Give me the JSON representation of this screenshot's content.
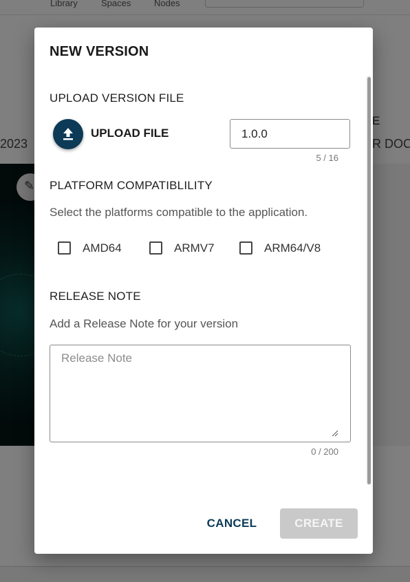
{
  "background": {
    "nav_links": [
      "Library",
      "Spaces",
      "Nodes"
    ],
    "date_fragment": "2023",
    "column_fragment": "E",
    "doc_fragment": "R DOC"
  },
  "dialog": {
    "title": "NEW VERSION",
    "upload_section": {
      "label": "UPLOAD VERSION FILE",
      "button_label": "UPLOAD FILE",
      "icon": "upload-icon",
      "version_value": "1.0.0",
      "version_counter": "5 / 16"
    },
    "platform_section": {
      "label": "PLATFORM COMPATIBLILITY",
      "description": "Select the platforms compatible to the application.",
      "options": [
        {
          "label": "AMD64",
          "checked": false
        },
        {
          "label": "ARMV7",
          "checked": false
        },
        {
          "label": "ARM64/V8",
          "checked": false
        }
      ]
    },
    "release_note_section": {
      "label": "RELEASE NOTE",
      "description": "Add a Release Note for your version",
      "placeholder": "Release Note",
      "counter": "0 / 200"
    },
    "actions": {
      "cancel_label": "CANCEL",
      "create_label": "CREATE"
    }
  },
  "colors": {
    "primary": "#0c3a57",
    "disabled_button": "#c9c9c9",
    "overlay": "rgba(0,0,0,0.5)"
  }
}
